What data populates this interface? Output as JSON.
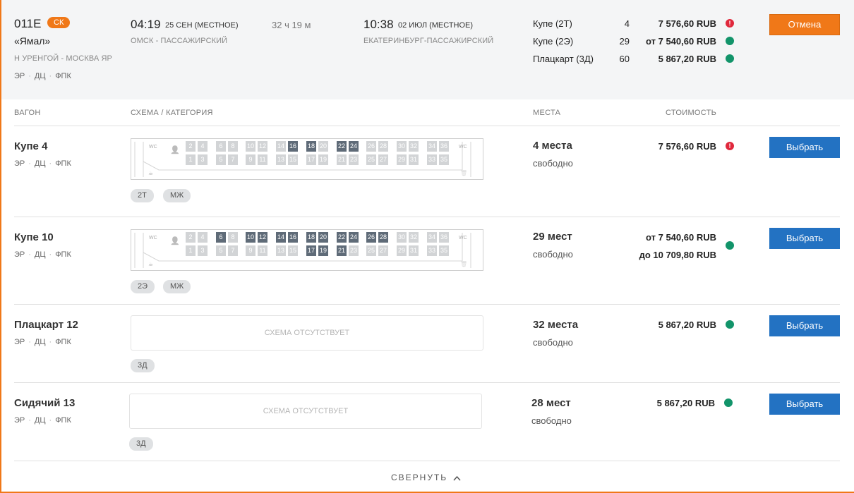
{
  "train": {
    "number": "011Е",
    "badge": "СК",
    "name": "«Ямал»",
    "route": "Н УРЕНГОЙ - МОСКВА ЯР",
    "carriers": [
      "ЭР",
      "ДЦ",
      "ФПК"
    ]
  },
  "departure": {
    "time": "04:19",
    "date": "25 СЕН (МЕСТНОЕ)",
    "station": "ОМСК - ПАССАЖИРСКИЙ"
  },
  "duration": "32 ч 19 м",
  "arrival": {
    "time": "10:38",
    "date": "02 ИЮЛ (МЕСТНОЕ)",
    "station": "ЕКАТЕРИНБУРГ-ПАССАЖИРСКИЙ"
  },
  "classes": [
    {
      "name": "Купе (2Т)",
      "count": "4",
      "price": "7 576,60 RUB",
      "status": "warn"
    },
    {
      "name": "Купе (2Э)",
      "count": "29",
      "price": "от 7 540,60 RUB",
      "status": "ok"
    },
    {
      "name": "Плацкарт (3Д)",
      "count": "60",
      "price": "5 867,20 RUB",
      "status": "ok"
    }
  ],
  "cancel_label": "Отмена",
  "columns": {
    "car": "ВАГОН",
    "scheme": "СХЕМА / КАТЕГОРИЯ",
    "seats": "МЕСТА",
    "price": "СТОИМОСТЬ"
  },
  "cars": [
    {
      "name": "Купе 4",
      "carriers": [
        "ЭР",
        "ДЦ",
        "ФПК"
      ],
      "seats": "4 места",
      "seats_sub": "свободно",
      "prices": [
        "7 576,60 RUB"
      ],
      "status": "warn",
      "tags": [
        "2Т",
        "МЖ"
      ],
      "select_label": "Выбрать",
      "scheme": {
        "busy": [
          16,
          18,
          22,
          24
        ]
      }
    },
    {
      "name": "Купе 10",
      "carriers": [
        "ЭР",
        "ДЦ",
        "ФПК"
      ],
      "seats": "29 мест",
      "seats_sub": "свободно",
      "prices": [
        "от 7 540,60 RUB",
        "до 10 709,80 RUB"
      ],
      "status": "ok",
      "tags": [
        "2Э",
        "МЖ"
      ],
      "select_label": "Выбрать",
      "scheme": {
        "busy": [
          6,
          10,
          12,
          14,
          16,
          18,
          17,
          20,
          19,
          22,
          21,
          24,
          26,
          28
        ]
      }
    },
    {
      "name": "Плацкарт 12",
      "carriers": [
        "ЭР",
        "ДЦ",
        "ФПК"
      ],
      "seats": "32 места",
      "seats_sub": "свободно",
      "prices": [
        "5 867,20 RUB"
      ],
      "status": "ok",
      "tags": [
        "3Д"
      ],
      "select_label": "Выбрать",
      "no_scheme": "СХЕМА ОТСУТСТВУЕТ"
    },
    {
      "name": "Сидячий 13",
      "carriers": [
        "ЭР",
        "ДЦ",
        "ФПК"
      ],
      "seats": "28 мест",
      "seats_sub": "свободно",
      "prices": [
        "5 867,20 RUB"
      ],
      "status": "ok",
      "tags": [
        "3Д"
      ],
      "select_label": "Выбрать",
      "no_scheme": "СХЕМА ОТСУТСТВУЕТ"
    }
  ],
  "scheme_labels": {
    "wc": "WC"
  },
  "collapse_label": "СВЕРНУТЬ",
  "colors": {
    "accent": "#f07818",
    "primary": "#2372c2",
    "ok": "#12946a",
    "warn": "#e0283c",
    "busy_seat": "#5f6b78"
  }
}
